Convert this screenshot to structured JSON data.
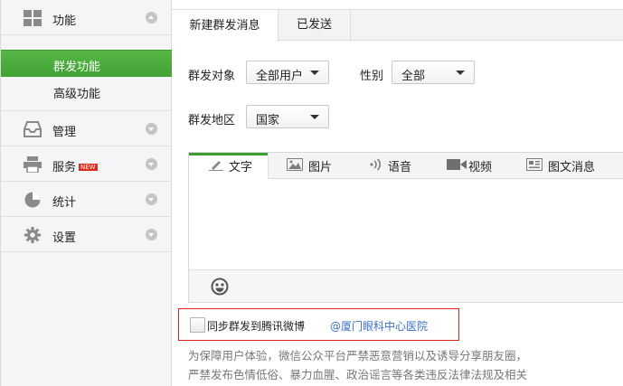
{
  "sidebar": {
    "items": [
      {
        "label": "功能",
        "icon": "grid-icon"
      },
      {
        "label": "管理",
        "icon": "inbox-icon"
      },
      {
        "label": "服务",
        "icon": "printer-icon",
        "badge": "NEW"
      },
      {
        "label": "统计",
        "icon": "pie-chart-icon"
      },
      {
        "label": "设置",
        "icon": "gear-icon"
      }
    ],
    "sub_items": [
      {
        "label": "群发功能",
        "active": true
      },
      {
        "label": "高级功能",
        "active": false
      }
    ]
  },
  "tabs": [
    {
      "label": "新建群发消息",
      "active": true
    },
    {
      "label": "已发送",
      "active": false
    }
  ],
  "form": {
    "target_label": "群发对象",
    "target_value": "全部用户",
    "gender_label": "性别",
    "gender_value": "全部",
    "region_label": "群发地区",
    "region_value": "国家"
  },
  "editor": {
    "tabs": [
      {
        "label": "文字",
        "icon": "pencil-icon",
        "active": true
      },
      {
        "label": "图片",
        "icon": "image-icon",
        "active": false
      },
      {
        "label": "语音",
        "icon": "voice-icon",
        "active": false
      },
      {
        "label": "视频",
        "icon": "video-icon",
        "active": false
      },
      {
        "label": "图文消息",
        "icon": "news-icon",
        "active": false
      }
    ],
    "emoji_icon": "smiley-icon"
  },
  "sync": {
    "label": "同步群发到腾讯微博",
    "account": "@厦门眼科中心医院",
    "checked": false
  },
  "notice": {
    "line1": "为保障用户体验，微信公众平台严禁恶意营销以及诱导分享朋友圈，",
    "line2": "严禁发布色情低俗、暴力血腥、政治谣言等各类违反法律法规及相关"
  },
  "colors": {
    "accent_green": "#44a536",
    "link_blue": "#3a73c5",
    "highlight_red": "#e0221b"
  }
}
